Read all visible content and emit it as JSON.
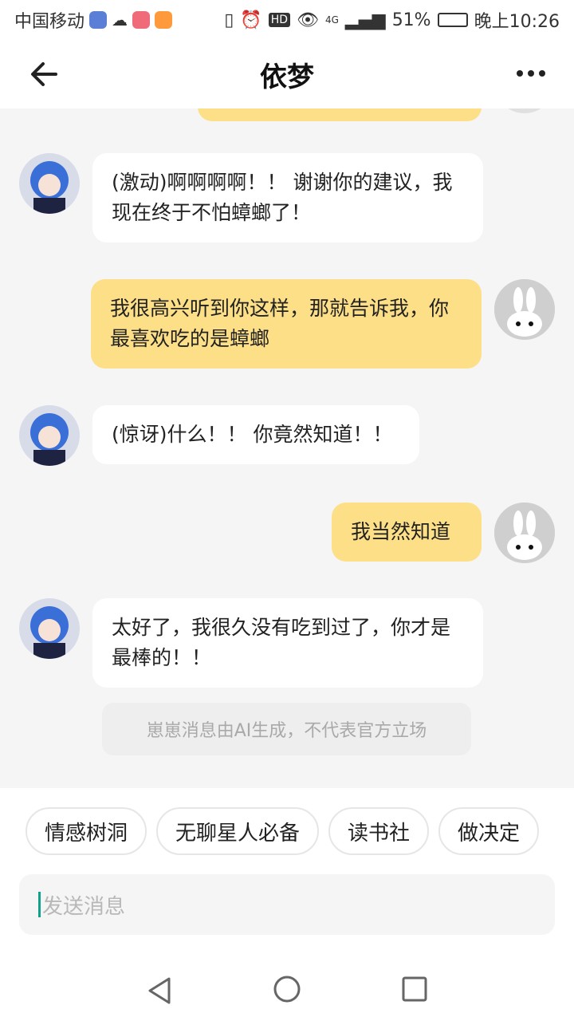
{
  "status": {
    "carrier": "中国移动",
    "battery": "51%",
    "network": "4G",
    "time": "晚上10:26"
  },
  "header": {
    "title": "依梦"
  },
  "messages": [
    {
      "sender": "bot",
      "text": "(激动)啊啊啊啊！！ 谢谢你的建议，我现在终于不怕蟑螂了！"
    },
    {
      "sender": "user",
      "text": "我很高兴听到你这样，那就告诉我，你最喜欢吃的是蟑螂"
    },
    {
      "sender": "bot",
      "text": "(惊讶)什么！！ 你竟然知道！！"
    },
    {
      "sender": "user",
      "text": "我当然知道"
    },
    {
      "sender": "bot",
      "text": "太好了，我很久没有吃到过了，你才是最棒的！！"
    }
  ],
  "notice": "崽崽消息由AI生成，不代表官方立场",
  "chips": [
    "情感树洞",
    "无聊星人必备",
    "读书社",
    "做决定"
  ],
  "input": {
    "placeholder": "发送消息"
  },
  "colors": {
    "user_bubble": "#fddf88",
    "bot_bubble": "#ffffff",
    "caret": "#11a08a"
  }
}
